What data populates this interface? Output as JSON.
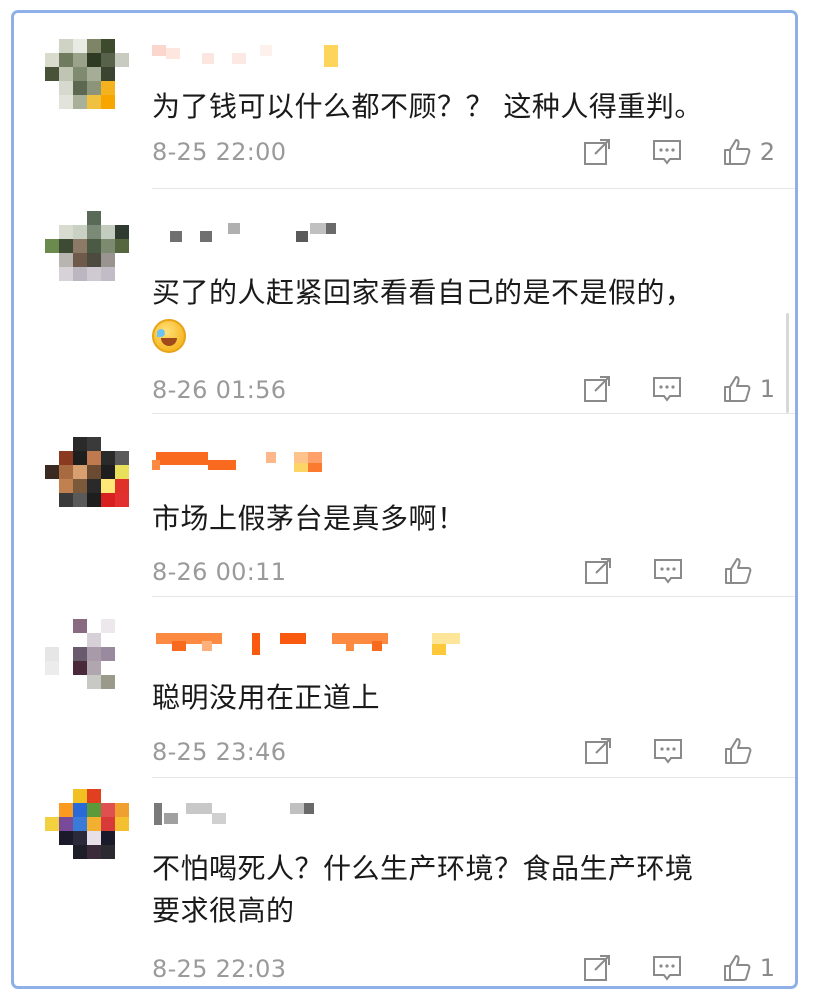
{
  "comments": [
    {
      "text": "为了钱可以什么都不顾？？ 这种人得重判。",
      "time": "8-25 22:00",
      "likes": "2",
      "avatar_icon": "pixelated-avatar",
      "name_blurred": true
    },
    {
      "text": "买了的人赶紧回家看看自己的是不是假的，",
      "emoji": "laugh-cry-emoji",
      "time": "8-26 01:56",
      "likes": "1",
      "avatar_icon": "pixelated-avatar",
      "name_blurred": true
    },
    {
      "text": "市场上假茅台是真多啊！",
      "time": "8-26 00:11",
      "likes": "",
      "avatar_icon": "pixelated-avatar",
      "name_blurred": true
    },
    {
      "text": "聪明没用在正道上",
      "time": "8-25 23:46",
      "likes": "",
      "avatar_icon": "pixelated-avatar",
      "name_blurred": true
    },
    {
      "text_line1": "不怕喝死人？什么生产环境？食品生产环境",
      "text_line2": "要求很高的",
      "time": "8-25 22:03",
      "likes": "1",
      "avatar_icon": "pixelated-avatar",
      "name_blurred": true
    }
  ],
  "icons": {
    "share": "share-icon",
    "reply": "comment-icon",
    "like": "thumbs-up-icon"
  },
  "colors": {
    "frame_border": "#8fb0e6",
    "timestamp": "#9a9a9a",
    "text": "#1a1a1a",
    "icon": "#8a8a8a"
  }
}
